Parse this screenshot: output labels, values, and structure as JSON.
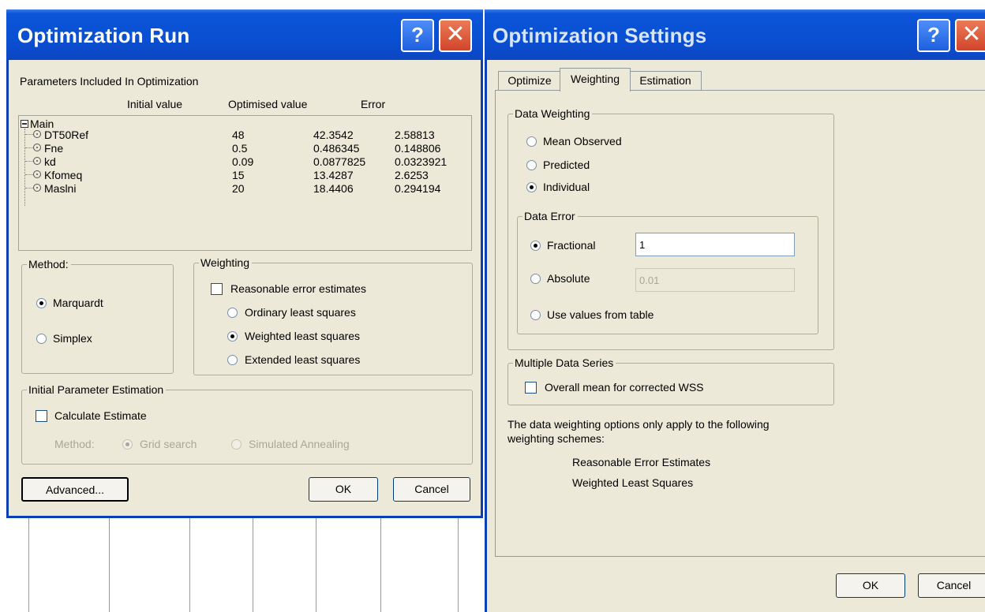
{
  "run_dialog": {
    "title": "Optimization Run",
    "help_label": "?",
    "close_label": "✕",
    "params_heading": "Parameters Included In Optimization",
    "columns": [
      "Initial value",
      "Optimised value",
      "Error"
    ],
    "root_label": "Main",
    "rows": [
      {
        "name": "DT50Ref",
        "initial": "48",
        "optimised": "42.3542",
        "error": "2.58813"
      },
      {
        "name": "Fne",
        "initial": "0.5",
        "optimised": "0.486345",
        "error": "0.148806"
      },
      {
        "name": "kd",
        "initial": "0.09",
        "optimised": "0.0877825",
        "error": "0.0323921"
      },
      {
        "name": "Kfomeq",
        "initial": "15",
        "optimised": "13.4287",
        "error": "2.6253"
      },
      {
        "name": "Maslni",
        "initial": "20",
        "optimised": "18.4406",
        "error": "0.294194"
      }
    ],
    "method": {
      "legend": "Method:",
      "options": [
        "Marquardt",
        "Simplex"
      ],
      "selected": "Marquardt"
    },
    "weighting": {
      "legend": "Weighting",
      "checkbox_label": "Reasonable error estimates",
      "checked": false,
      "options": [
        "Ordinary least squares",
        "Weighted least squares",
        "Extended least squares"
      ],
      "selected": "Weighted least squares"
    },
    "initial_estimation": {
      "legend": "Initial Parameter Estimation",
      "checkbox_label": "Calculate Estimate",
      "checked": false,
      "method_label": "Method:",
      "options": [
        "Grid search",
        "Simulated Annealing"
      ],
      "selected": "Grid search"
    },
    "buttons": {
      "advanced": "Advanced...",
      "ok": "OK",
      "cancel": "Cancel"
    }
  },
  "settings_dialog": {
    "title": "Optimization Settings",
    "help_label": "?",
    "close_label": "✕",
    "tabs": [
      "Optimize",
      "Weighting",
      "Estimation"
    ],
    "active_tab": "Weighting",
    "data_weighting": {
      "legend": "Data Weighting",
      "options": [
        "Mean Observed",
        "Predicted",
        "Individual"
      ],
      "selected": "Individual"
    },
    "data_error": {
      "legend": "Data Error",
      "options": [
        "Fractional",
        "Absolute",
        "Use values from table"
      ],
      "selected": "Fractional",
      "fractional_value": "1",
      "absolute_value": "0.01"
    },
    "multiple_series": {
      "legend": "Multiple Data Series",
      "checkbox_label": "Overall mean for corrected WSS",
      "checked": false
    },
    "note_line1": "The data weighting options only apply to the following",
    "note_line2": "weighting schemes:",
    "schemes": [
      "Reasonable Error Estimates",
      "Weighted Least Squares"
    ],
    "buttons": {
      "ok": "OK",
      "cancel": "Cancel"
    }
  }
}
